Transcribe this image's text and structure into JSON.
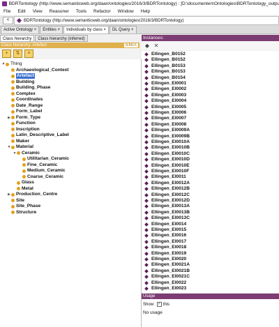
{
  "window": {
    "title": "BDRTontology (http://www.semanticweb.org/daan/ontologies/2016/3/BDRTontology) : [D:\\documenten\\Ontologies\\BDRTontology_output.owl]"
  },
  "menu": [
    "File",
    "Edit",
    "View",
    "Reasoner",
    "Tools",
    "Refactor",
    "Window",
    "Help"
  ],
  "address": {
    "back_label": "<",
    "text": "BDRTontology (http://www.semanticweb.org/daan/ontologies/2016/3/BDRTontology)"
  },
  "tabs": [
    {
      "label": "Active Ontology ×",
      "active": false
    },
    {
      "label": "Entities ×",
      "active": false
    },
    {
      "label": "Individuals by class ×",
      "active": true
    },
    {
      "label": "DL Query ×",
      "active": false
    }
  ],
  "left_panel": {
    "subtabs": [
      {
        "label": "Class hierarchy",
        "active": true
      },
      {
        "label": "Class hierarchy (inferred)",
        "active": false
      }
    ],
    "header": "Class hierarchy: Artefact",
    "header_badge": "IEBEIX",
    "toolbar": [
      "add-subclass-icon",
      "add-sibling-icon",
      "delete-class-icon"
    ],
    "tree": [
      {
        "label": "Thing",
        "depth": 0,
        "toggle": "▼",
        "thing": true
      },
      {
        "label": "Archaeological_Context",
        "depth": 1,
        "toggle": ""
      },
      {
        "label": "Artefact",
        "depth": 1,
        "toggle": "",
        "selected": true
      },
      {
        "label": "Building",
        "depth": 1,
        "toggle": ""
      },
      {
        "label": "Building_Phase",
        "depth": 1,
        "toggle": ""
      },
      {
        "label": "Complex",
        "depth": 1,
        "toggle": ""
      },
      {
        "label": "Coordinates",
        "depth": 1,
        "toggle": ""
      },
      {
        "label": "Date_Range",
        "depth": 1,
        "toggle": ""
      },
      {
        "label": "Form_Label",
        "depth": 1,
        "toggle": ""
      },
      {
        "label": "Form_Type",
        "depth": 1,
        "toggle": "▶"
      },
      {
        "label": "Function",
        "depth": 1,
        "toggle": ""
      },
      {
        "label": "Inscription",
        "depth": 1,
        "toggle": ""
      },
      {
        "label": "Latin_Descriptive_Label",
        "depth": 1,
        "toggle": ""
      },
      {
        "label": "Maker",
        "depth": 1,
        "toggle": ""
      },
      {
        "label": "Material",
        "depth": 1,
        "toggle": "▼"
      },
      {
        "label": "Ceramic",
        "depth": 2,
        "toggle": "▼"
      },
      {
        "label": "Utilitarian_Ceramic",
        "depth": 3,
        "toggle": ""
      },
      {
        "label": "Fine_Ceramic",
        "depth": 3,
        "toggle": ""
      },
      {
        "label": "Medium_Ceramic",
        "depth": 3,
        "toggle": ""
      },
      {
        "label": "Coarse_Ceramic",
        "depth": 3,
        "toggle": ""
      },
      {
        "label": "Glass",
        "depth": 2,
        "toggle": ""
      },
      {
        "label": "Metal",
        "depth": 2,
        "toggle": ""
      },
      {
        "label": "Production_Centre",
        "depth": 1,
        "toggle": "▶"
      },
      {
        "label": "Site",
        "depth": 1,
        "toggle": ""
      },
      {
        "label": "Site_Phase",
        "depth": 1,
        "toggle": ""
      },
      {
        "label": "Structure",
        "depth": 1,
        "toggle": ""
      }
    ]
  },
  "right_panel": {
    "header": "Instances:",
    "toolbar": [
      "add-individual-icon",
      "delete-individual-icon"
    ],
    "instances": [
      "Ellingen_B0152",
      "Ellingen_B0152",
      "Ellingen_B0153",
      "Ellingen_B0153",
      "Ellingen_B0154",
      "Ellingen_EI0001",
      "Ellingen_EI0002",
      "Ellingen_EI0003",
      "Ellingen_EI0004",
      "Ellingen_EI0005",
      "Ellingen_EI0006",
      "Ellingen_EI0007",
      "Ellingen_EI0008",
      "Ellingen_EI0009A",
      "Ellingen_EI0009B",
      "Ellingen_EI0010A",
      "Ellingen_EI0010B",
      "Ellingen_EI0010C",
      "Ellingen_EI0010D",
      "Ellingen_EI0010E",
      "Ellingen_EI0010F",
      "Ellingen_EI0011",
      "Ellingen_EI0012A",
      "Ellingen_EI0012B",
      "Ellingen_EI0012C",
      "Ellingen_EI0012D",
      "Ellingen_EI0013A",
      "Ellingen_EI0013B",
      "Ellingen_EI0013C",
      "Ellingen_EI0014",
      "Ellingen_EI0015",
      "Ellingen_EI0016",
      "Ellingen_EI0017",
      "Ellingen_EI0018",
      "Ellingen_EI0019",
      "Ellingen_EI0020",
      "Ellingen_EI0021A",
      "Ellingen_EI0021B",
      "Ellingen_EI0021C",
      "Ellingen_EI0022",
      "Ellingen_EI0023"
    ]
  },
  "usage": {
    "header": "Usage",
    "show_label": "Show:",
    "this_label": "this",
    "this_checked": "✓",
    "text": "No usage"
  }
}
